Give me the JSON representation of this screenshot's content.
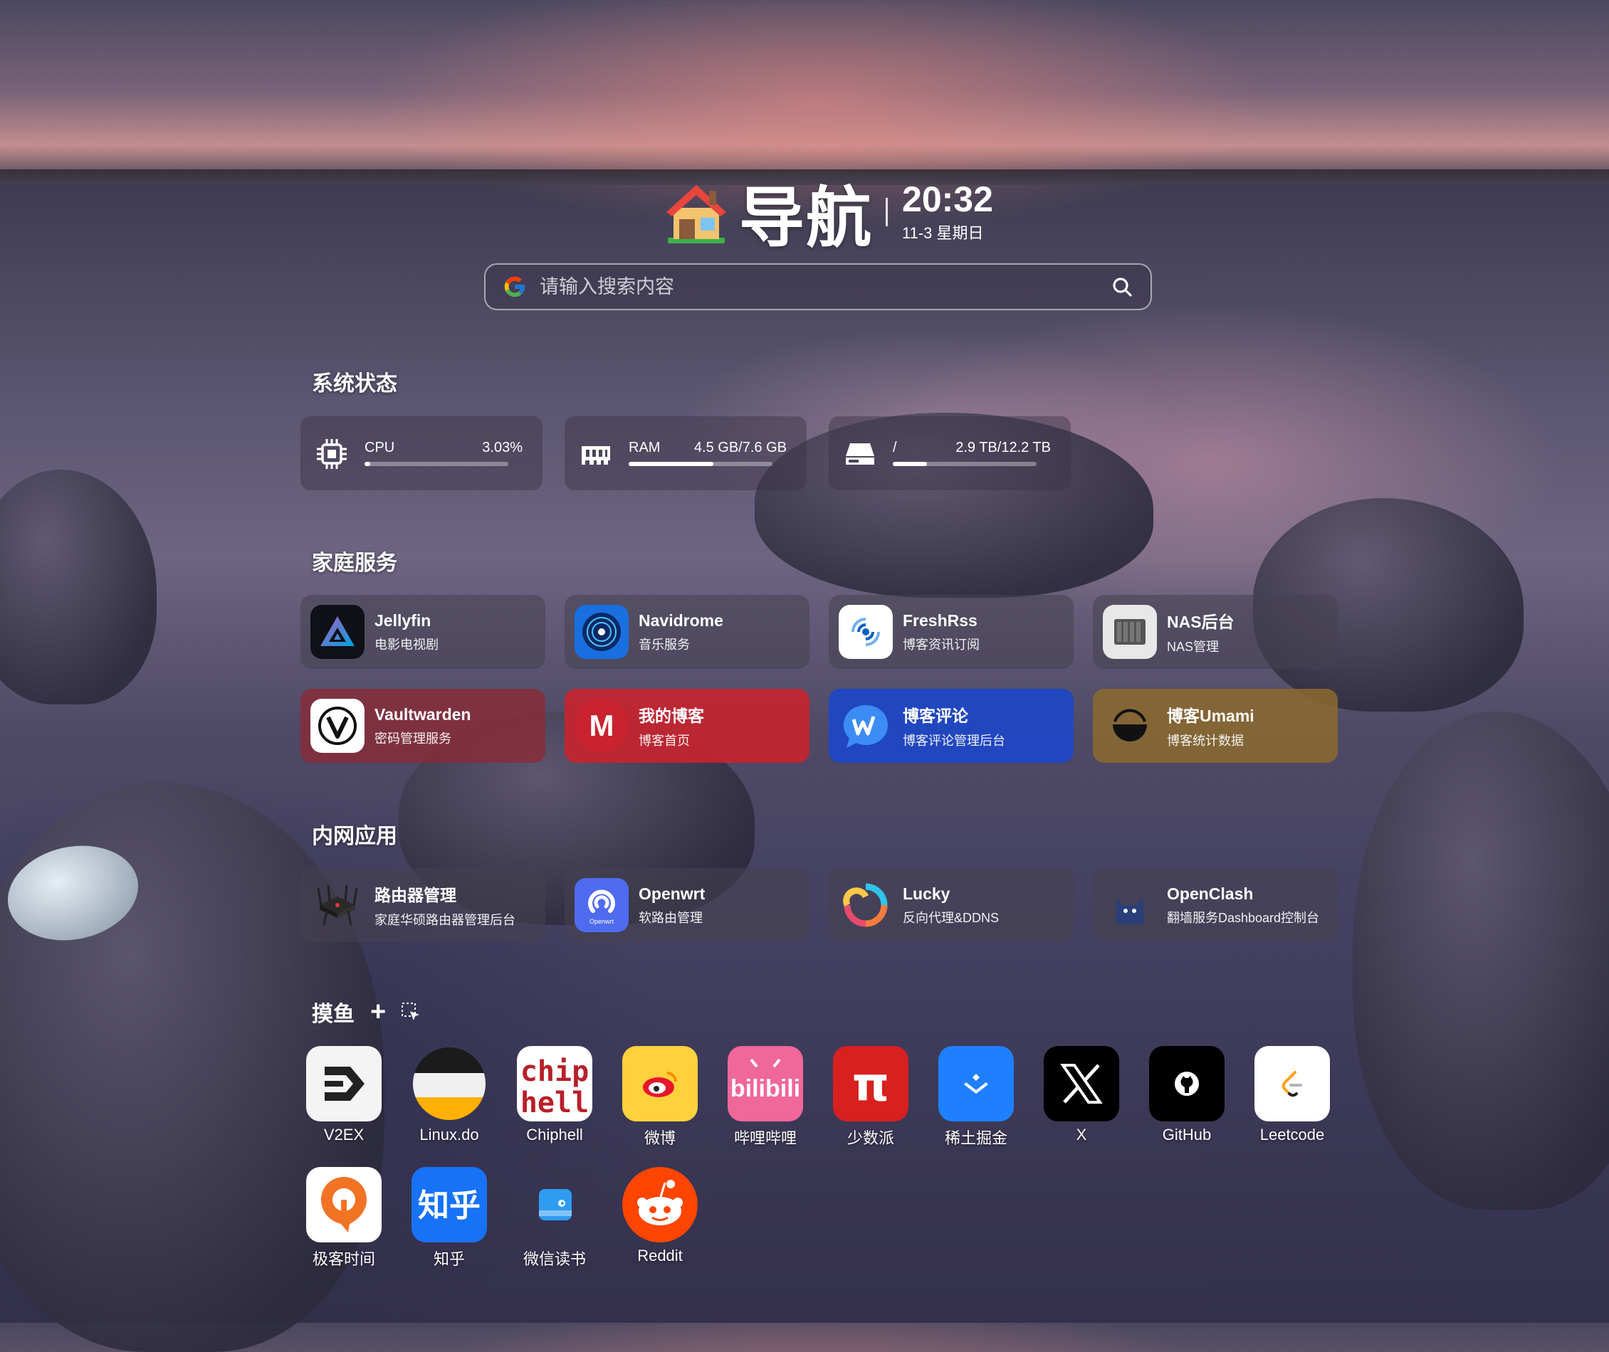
{
  "header": {
    "title": "导航",
    "time": "20:32",
    "date": "11-3 星期日"
  },
  "search": {
    "placeholder": "请输入搜索内容"
  },
  "system_status": {
    "title": "系统状态",
    "cpu": {
      "label": "CPU",
      "value": "3.03%",
      "fraction": 0.03
    },
    "ram": {
      "label": "RAM",
      "value": "4.5 GB/7.6 GB",
      "fraction": 0.59
    },
    "disk": {
      "label": "/",
      "value": "2.9 TB/12.2 TB",
      "fraction": 0.24
    }
  },
  "home_services": {
    "title": "家庭服务",
    "items": [
      {
        "name": "Jellyfin",
        "desc": "电影电视剧",
        "color": ""
      },
      {
        "name": "Navidrome",
        "desc": "音乐服务",
        "color": ""
      },
      {
        "name": "FreshRss",
        "desc": "博客资讯订阅",
        "color": ""
      },
      {
        "name": "NAS后台",
        "desc": "NAS管理",
        "color": ""
      },
      {
        "name": "Vaultwarden",
        "desc": "密码管理服务",
        "color": "#8a2a36"
      },
      {
        "name": "我的博客",
        "desc": "博客首页",
        "color": "#c8232f"
      },
      {
        "name": "博客评论",
        "desc": "博客评论管理后台",
        "color": "#1f47c4"
      },
      {
        "name": "博客Umami",
        "desc": "博客统计数据",
        "color": "#8c6a2e"
      }
    ]
  },
  "lan_apps": {
    "title": "内网应用",
    "items": [
      {
        "name": "路由器管理",
        "desc": "家庭华硕路由器管理后台"
      },
      {
        "name": "Openwrt",
        "desc": "软路由管理"
      },
      {
        "name": "Lucky",
        "desc": "反向代理&DDNS"
      },
      {
        "name": "OpenClash",
        "desc": "翻墙服务Dashboard控制台"
      }
    ]
  },
  "fun": {
    "title": "摸鱼",
    "add_label": "+",
    "items": [
      {
        "label": "V2EX"
      },
      {
        "label": "Linux.do"
      },
      {
        "label": "Chiphell"
      },
      {
        "label": "微博"
      },
      {
        "label": "哔哩哔哩"
      },
      {
        "label": "少数派"
      },
      {
        "label": "稀土掘金"
      },
      {
        "label": "X"
      },
      {
        "label": "GitHub"
      },
      {
        "label": "Leetcode"
      },
      {
        "label": "极客时间"
      },
      {
        "label": "知乎"
      },
      {
        "label": "微信读书"
      },
      {
        "label": "Reddit"
      }
    ],
    "tile_text": {
      "chiphell": "chip hell",
      "bilibili": "bilibili",
      "sspai": "π",
      "zhihu": "知乎"
    }
  },
  "icons": {
    "house": "house-icon",
    "google": "google-icon",
    "search": "search-icon",
    "cpu": "cpu-icon",
    "ram": "ram-icon",
    "disk": "disk-icon",
    "select": "select-icon"
  },
  "colors": {
    "vaultwarden": "#8a2a36",
    "blog": "#c8232f",
    "comment": "#1f47c4",
    "umami": "#8c6a2e",
    "jellyfin_bg": "#101018",
    "navidrome": "#1a6fe0",
    "weibo_bg": "#ffd13c",
    "bilibili": "#f0679a",
    "sspai": "#d7201f",
    "juejin": "#1e80ff",
    "zhihu": "#1772f6",
    "reddit": "#ff4500",
    "geektime": "#f27324"
  }
}
